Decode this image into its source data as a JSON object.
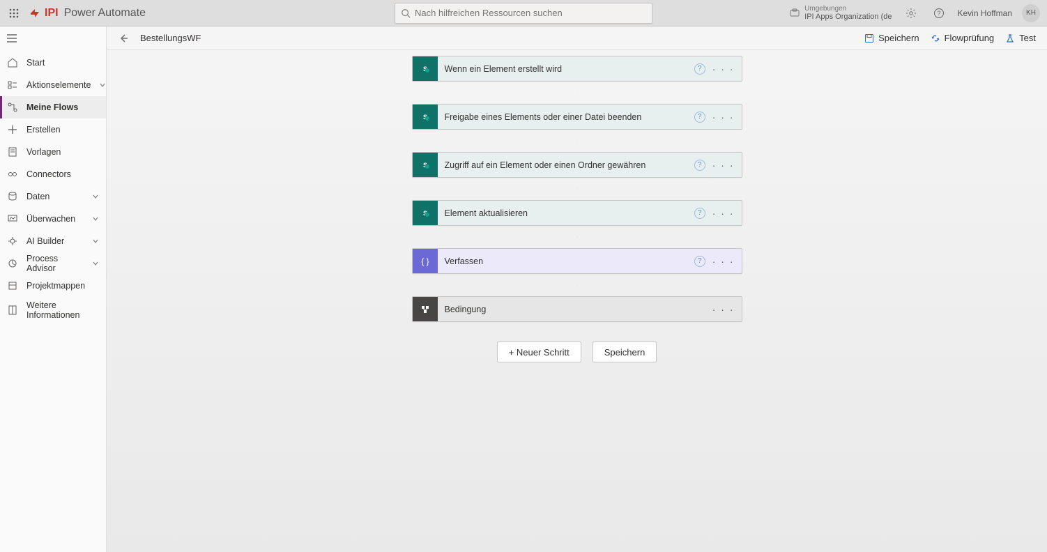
{
  "header": {
    "brand_text": "IPI",
    "app_name": "Power Automate",
    "search_placeholder": "Nach hilfreichen Ressourcen suchen",
    "env_label": "Umgebungen",
    "env_name": "IPI Apps Organization (de",
    "user_name": "Kevin Hoffman",
    "user_initials": "KH"
  },
  "sidebar": {
    "items": [
      {
        "label": "Start",
        "icon": "home-icon",
        "expandable": false,
        "active": false
      },
      {
        "label": "Aktionselemente",
        "icon": "items-icon",
        "expandable": true,
        "active": false
      },
      {
        "label": "Meine Flows",
        "icon": "flows-icon",
        "expandable": false,
        "active": true
      },
      {
        "label": "Erstellen",
        "icon": "plus-icon",
        "expandable": false,
        "active": false
      },
      {
        "label": "Vorlagen",
        "icon": "template-icon",
        "expandable": false,
        "active": false
      },
      {
        "label": "Connectors",
        "icon": "connector-icon",
        "expandable": false,
        "active": false
      },
      {
        "label": "Daten",
        "icon": "data-icon",
        "expandable": true,
        "active": false
      },
      {
        "label": "Überwachen",
        "icon": "monitor-icon",
        "expandable": true,
        "active": false
      },
      {
        "label": "AI Builder",
        "icon": "ai-icon",
        "expandable": true,
        "active": false
      },
      {
        "label": "Process Advisor",
        "icon": "process-icon",
        "expandable": true,
        "active": false
      },
      {
        "label": "Projektmappen",
        "icon": "solution-icon",
        "expandable": false,
        "active": false
      },
      {
        "label": "Weitere Informationen",
        "icon": "book-icon",
        "expandable": false,
        "active": false
      }
    ]
  },
  "toolbar": {
    "flow_name": "BestellungsWF",
    "save_label": "Speichern",
    "check_label": "Flowprüfung",
    "test_label": "Test"
  },
  "steps": [
    {
      "title": "Wenn ein Element erstellt wird",
      "style": "sp-teal",
      "icon": "sharepoint-icon",
      "help": true
    },
    {
      "title": "Freigabe eines Elements oder einer Datei beenden",
      "style": "sp-teal",
      "icon": "sharepoint-icon",
      "help": true
    },
    {
      "title": "Zugriff auf ein Element oder einen Ordner gewähren",
      "style": "sp-teal",
      "icon": "sharepoint-icon",
      "help": true
    },
    {
      "title": "Element aktualisieren",
      "style": "sp-teal",
      "icon": "sharepoint-icon",
      "help": true
    },
    {
      "title": "Verfassen",
      "style": "sp-purple",
      "icon": "compose-icon",
      "help": true
    },
    {
      "title": "Bedingung",
      "style": "sp-gray",
      "icon": "condition-icon",
      "help": false
    }
  ],
  "buttons": {
    "new_step": "+ Neuer Schritt",
    "save": "Speichern"
  },
  "colors": {
    "teal": "#0f7167",
    "purple": "#6b69d6",
    "gray_dark": "#484644",
    "accent": "#742774"
  }
}
